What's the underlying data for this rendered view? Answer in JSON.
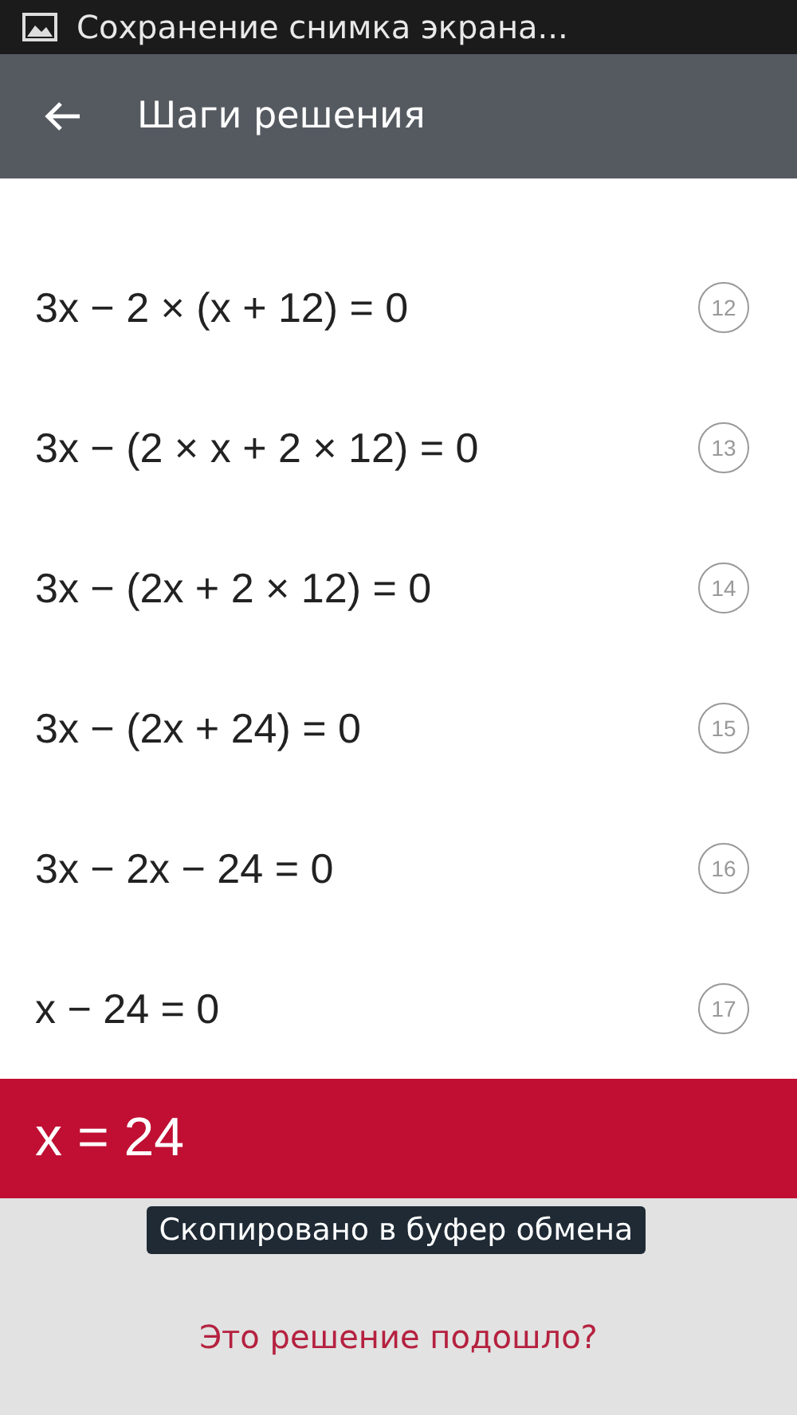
{
  "status_bar": {
    "notification": "Сохранение снимка экрана..."
  },
  "app_bar": {
    "title": "Шаги решения"
  },
  "steps": [
    {
      "expression": "3x − 2 × (x + 12) = 0",
      "number": "12"
    },
    {
      "expression": "3x − (2 × x + 2 × 12) = 0",
      "number": "13"
    },
    {
      "expression": "3x − (2x + 2 × 12) = 0",
      "number": "14"
    },
    {
      "expression": "3x − (2x + 24) = 0",
      "number": "15"
    },
    {
      "expression": "3x − 2x − 24 = 0",
      "number": "16"
    },
    {
      "expression": "x − 24 = 0",
      "number": "17"
    }
  ],
  "result": "x = 24",
  "toast": "Скопировано в буфер обмена",
  "feedback_link": "Это решение подошло?"
}
